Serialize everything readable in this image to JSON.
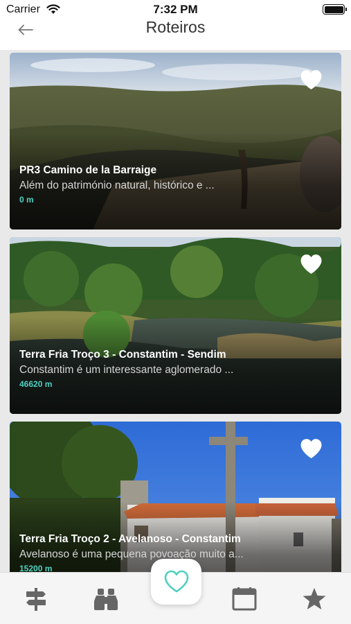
{
  "status_bar": {
    "carrier": "Carrier",
    "time": "7:32 PM"
  },
  "nav": {
    "title": "Roteiros"
  },
  "routes": [
    {
      "title": "PR3 Camino de la Barraige",
      "description": "Além do património natural, histórico e ...",
      "distance": "0 m",
      "favorite_icon": "heart-icon"
    },
    {
      "title": "Terra Fria Troço 3 - Constantim - Sendim",
      "description": "Constantim é um interessante aglomerado ...",
      "distance": "46620 m",
      "favorite_icon": "heart-icon"
    },
    {
      "title": "Terra Fria Troço 2 - Avelanoso - Constantim",
      "description": "Avelanoso é uma pequena povoação muito a...",
      "distance": "15200 m",
      "favorite_icon": "heart-icon"
    }
  ],
  "tab_bar": {
    "tabs": [
      "signpost-icon",
      "binoculars-icon",
      "heart-icon",
      "calendar-icon",
      "star-icon"
    ],
    "active": "heart-icon"
  },
  "colors": {
    "accent": "#4fd0c0",
    "icon_gray": "#666666",
    "list_background": "#e9e9e9"
  }
}
